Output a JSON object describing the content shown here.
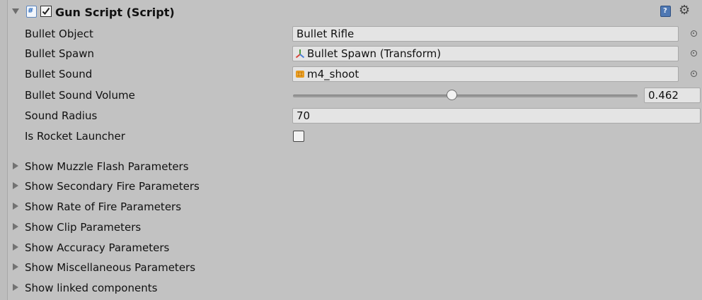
{
  "component": {
    "title": "Gun Script (Script)",
    "enabled": true,
    "script_icon_glyph": "#",
    "help_icon_glyph": "?",
    "gear_icon_glyph": "⚙"
  },
  "fields": {
    "bullet_object": {
      "label": "Bullet Object",
      "value": "Bullet Rifle"
    },
    "bullet_spawn": {
      "label": "Bullet Spawn",
      "value": "Bullet Spawn (Transform)",
      "icon": "transform-icon"
    },
    "bullet_sound": {
      "label": "Bullet Sound",
      "value": "m4_shoot",
      "icon": "audio-clip-icon"
    },
    "bullet_sound_volume": {
      "label": "Bullet Sound Volume",
      "value": "0.462",
      "fraction": 0.462
    },
    "sound_radius": {
      "label": "Sound Radius",
      "value": "70"
    },
    "is_rocket_launcher": {
      "label": "Is Rocket Launcher",
      "checked": false
    }
  },
  "foldouts": [
    {
      "label": "Show Muzzle Flash Parameters"
    },
    {
      "label": "Show Secondary Fire Parameters"
    },
    {
      "label": "Show Rate of Fire Parameters"
    },
    {
      "label": "Show Clip Parameters"
    },
    {
      "label": "Show Accuracy Parameters"
    },
    {
      "label": "Show Miscellaneous Parameters"
    },
    {
      "label": "Show linked components"
    }
  ],
  "colors": {
    "background": "#c2c2c2",
    "field_background": "#e4e4e4",
    "script_icon_accent": "#2d6cc0",
    "transform_red": "#d8473a",
    "transform_green": "#7ab648",
    "transform_blue": "#4a7ed6",
    "audio_icon": "#e69a1e"
  }
}
